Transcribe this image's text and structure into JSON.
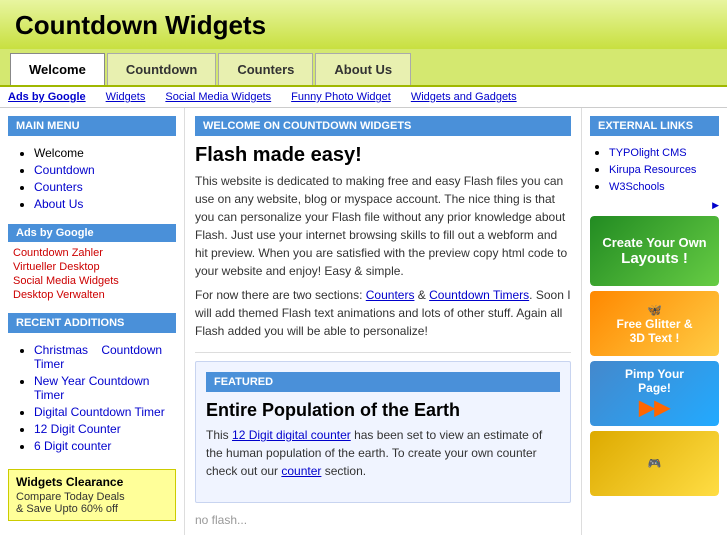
{
  "header": {
    "title": "Countdown Widgets"
  },
  "nav": {
    "tabs": [
      {
        "label": "Welcome",
        "active": true
      },
      {
        "label": "Countdown",
        "active": false
      },
      {
        "label": "Counters",
        "active": false
      },
      {
        "label": "About Us",
        "active": false
      }
    ]
  },
  "adbar": {
    "ads_label": "Ads by Google",
    "links": [
      "Widgets",
      "Social Media Widgets",
      "Funny Photo Widget",
      "Widgets and Gadgets"
    ]
  },
  "left_sidebar": {
    "main_menu_title": "MAIN MENU",
    "menu_items": [
      "Welcome",
      "Countdown",
      "Counters",
      "About Us"
    ],
    "ads_title": "Ads by Google",
    "ad_links": [
      "Countdown Zahler",
      "Virtueller Desktop",
      "Social Media Widgets",
      "Desktop Verwalten"
    ],
    "recent_title": "RECENT ADDITIONS",
    "recent_items": [
      "Christmas Countdown Timer",
      "New Year Countdown Timer",
      "Digital Countdown Timer",
      "12 Digit Counter",
      "6 Digit counter"
    ]
  },
  "center": {
    "welcome_title": "WELCOME ON COUNTDOWN WIDGETS",
    "main_heading": "Flash made easy!",
    "intro_text": "This website is dedicated to making free and easy Flash files you can use on any website, blog or myspace account. The nice thing is that you can personalize your Flash file without any prior knowledge about Flash. Just use your internet browsing skills to fill out a webform and hit preview. When you are satisfied with the preview copy html code to your website and enjoy! Easy & simple.",
    "intro_text2": "For now there are two sections:",
    "counters_link": "Counters",
    "amp": " & ",
    "countdown_link": "Countdown Timers",
    "intro_text3": ". Soon I will add themed Flash text animations and lots of other stuff. Again all Flash added you will be able to personalize!",
    "featured_title": "FEATURED",
    "featured_heading": "Entire Population of the Earth",
    "featured_link_text": "12 Digit digital counter",
    "featured_text": "has been set to view an estimate of the human population of the earth. To create your own counter check out our",
    "counter_link": "counter",
    "featured_text2": "section.",
    "no_flash": "no flash..."
  },
  "right_sidebar": {
    "ext_title": "EXTERNAL LINKS",
    "ext_links": [
      "TYPOlight CMS",
      "Kirupa Resources",
      "W3Schools"
    ],
    "ad_arrow": "▶",
    "widget1": {
      "line1": "Create Your Own",
      "line2": "Layouts !"
    },
    "widget2": {
      "line1": "Free Glitter &",
      "line2": "3D Text !"
    },
    "widget3": {
      "line1": "Pimp Your",
      "line2": "Page!"
    },
    "widget4": {
      "line1": ""
    }
  },
  "clearance": {
    "title": "Widgets Clearance",
    "line1": "Compare Today Deals",
    "line2": "& Save Upto 60% off"
  }
}
